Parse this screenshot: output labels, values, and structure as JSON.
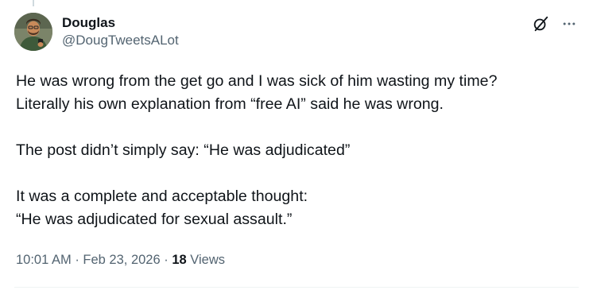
{
  "author": {
    "display_name": "Douglas",
    "handle": "@DougTweetsALot"
  },
  "icons": {
    "grok": "grok-icon",
    "more": "more-icon"
  },
  "tweet": {
    "line1": "He was wrong from the get go and I was sick of him wasting my time?",
    "line2": "Literally his own explanation from “free AI” said he was wrong.",
    "line3": "The post didn’t simply say: “He was adjudicated”",
    "line4": "It was a complete and acceptable thought:",
    "line5": "“He was adjudicated for sexual assault.”"
  },
  "meta": {
    "time": "10:01 AM",
    "separator": "·",
    "date": "Feb 23, 2026",
    "views_count": "18",
    "views_label": "Views"
  },
  "colors": {
    "text": "#0f1419",
    "secondary": "#536471",
    "divider": "#eff3f4"
  }
}
